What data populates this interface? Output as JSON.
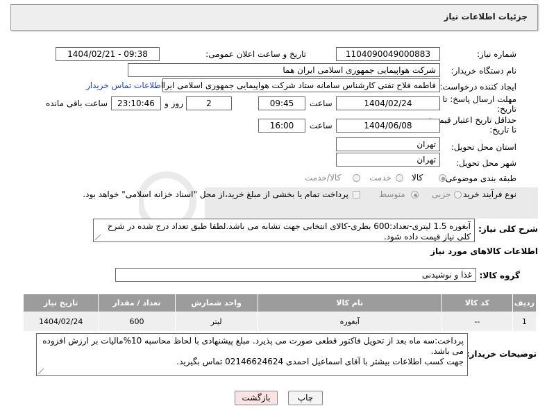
{
  "header": {
    "title": "جزئیات اطلاعات نیاز"
  },
  "fields": {
    "need_number_label": "شماره نیاز:",
    "need_number": "1104090049000883",
    "announce_label": "تاریخ و ساعت اعلان عمومی:",
    "announce_value": "1404/02/21 - 09:38",
    "buyer_org_label": "نام دستگاه خریدار:",
    "buyer_org": "شرکت هواپیمایی جمهوری اسلامی ایران هما",
    "requester_label": "ایجاد کننده درخواست:",
    "requester": "فاطمه فلاح تفتی کارشناس سامانه ستاد شرکت هواپیمایی جمهوری اسلامی ایران هما",
    "buyer_contact_link": "اطلاعات تماس خریدار",
    "deadline_label_1": "مهلت ارسال پاسخ: تا",
    "deadline_label_2": "تاریخ:",
    "deadline_date": "1404/02/24",
    "time_label": "ساعت",
    "deadline_time": "09:45",
    "days_value": "2",
    "day_and_label": "روز و",
    "remaining_time": "23:10:46",
    "remaining_label": "ساعت باقی مانده",
    "price_label_1": "حداقل تاریخ اعتبار قیمت:",
    "price_label_2": "تا تاریخ:",
    "price_date": "1404/06/08",
    "price_time": "16:00",
    "province_label": "استان محل تحویل:",
    "province": "تهران",
    "city_label": "شهر محل تحویل:",
    "city": "تهران",
    "category_label": "طبقه بندی موضوعی:",
    "category_options": [
      "کالا",
      "خدمت",
      "کالا/خدمت"
    ],
    "process_label": "نوع فرآیند خرید :",
    "process_options": [
      "جزیی",
      "متوسط"
    ],
    "payment_note": "پرداخت تمام یا بخشی از مبلغ خرید،از محل \"اسناد خزانه اسلامی\" خواهد بود."
  },
  "description": {
    "label": "شرح کلی نیاز:",
    "text": "آبغوره 1.5 لیتری-تعداد:600 بطری-کالای انتخابی جهت تشابه می باشد.لطفا طبق تعداد درج شده در شرح کلی نیاز قیمت داده شود."
  },
  "goods": {
    "section_title": "اطلاعات کالاهای مورد نیاز",
    "group_label": "گروه کالا:",
    "group_value": "غذا و نوشیدنی",
    "columns": [
      "ردیف",
      "کد کالا",
      "نام کالا",
      "واحد شمارش",
      "تعداد / مقدار",
      "تاریخ نیاز"
    ],
    "rows": [
      [
        "1",
        "--",
        "آبغوره",
        "لیتر",
        "600",
        "1404/02/24"
      ]
    ]
  },
  "buyer_notes": {
    "label": "توضیحات خریدار:",
    "line1": "پرداخت:سه ماه بعد از تحویل فاکتور قطعی صورت می پذیرد. مبلغ پیشنهادی با لحاظ محاسبه 10%مالیات بر ارزش افزوده می باشد.",
    "line2": "جهت کسب اطلاعات بیشتر با آقای اسماعیل احمدی 02146624624 تماس بگیرید."
  },
  "buttons": {
    "print": "چاپ",
    "back": "بازگشت"
  },
  "colors": {
    "header_bg": "#eeeeee",
    "table_header": "#9c9c9c",
    "link": "#1f3fbf",
    "back_button": "#fbe3e3"
  }
}
